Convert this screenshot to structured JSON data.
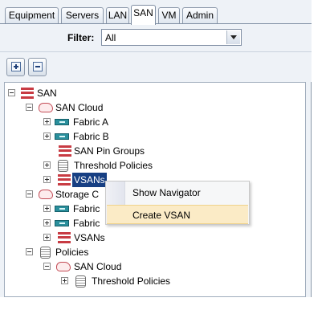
{
  "tabs": [
    "Equipment",
    "Servers",
    "LAN",
    "SAN",
    "VM",
    "Admin"
  ],
  "active_tab": "SAN",
  "filter": {
    "label": "Filter:",
    "value": "All"
  },
  "toolbar": {
    "expand_icon": "plus-square-icon",
    "collapse_icon": "minus-square-icon"
  },
  "tree": {
    "nodes": [
      {
        "label": "SAN",
        "icon": "san-list-icon"
      },
      {
        "label": "SAN Cloud",
        "icon": "cloud-icon"
      },
      {
        "label": "Fabric A",
        "icon": "fabric-icon"
      },
      {
        "label": "Fabric B",
        "icon": "fabric-icon"
      },
      {
        "label": "SAN Pin Groups",
        "icon": "pin-group-icon"
      },
      {
        "label": "Threshold Policies",
        "icon": "policy-icon"
      },
      {
        "label": "VSANs",
        "icon": "vsan-icon"
      },
      {
        "label": "Storage C",
        "icon": "cloud-icon"
      },
      {
        "label": "Fabric",
        "icon": "fabric-icon"
      },
      {
        "label": "Fabric",
        "icon": "fabric-icon"
      },
      {
        "label": "VSANs",
        "icon": "vsan-icon"
      },
      {
        "label": "Policies",
        "icon": "policy-icon"
      },
      {
        "label": "SAN Cloud",
        "icon": "cloud-icon"
      },
      {
        "label": "Threshold Policies",
        "icon": "policy-icon"
      }
    ]
  },
  "context_menu": {
    "items": [
      "Show Navigator",
      "Create VSAN"
    ],
    "highlighted": "Create VSAN"
  },
  "colors": {
    "panel_bg": "#eef2f7",
    "selection": "#173f83",
    "menu_hover": "#fbebc6",
    "icon_red": "#c83b43",
    "icon_teal": "#2a8f9c"
  }
}
